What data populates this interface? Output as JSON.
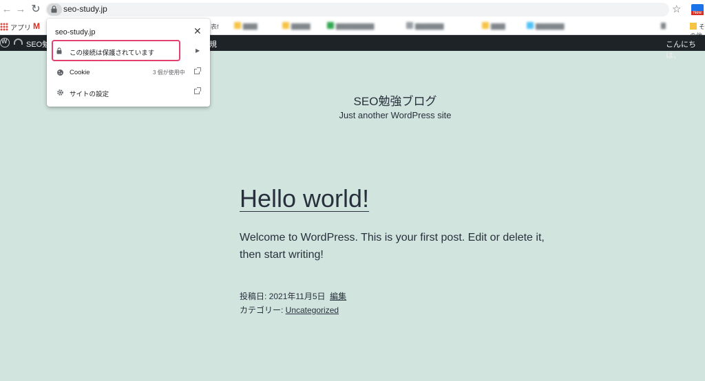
{
  "browser": {
    "url": "seo-study.jp",
    "bookmarks": {
      "apps_label": "アプリ",
      "gmail_label": "M",
      "partial_label": "表f",
      "right_label": "その他"
    }
  },
  "adminbar": {
    "site_name": "SEO勉",
    "new_label": "規",
    "howdy": "こんにちは、"
  },
  "popup": {
    "host": "seo-study.jp",
    "close": "✕",
    "secure_label": "この接続は保護されています",
    "cookie_label": "Cookie",
    "cookie_count": "3 個が使用中",
    "site_settings_label": "サイトの設定"
  },
  "site": {
    "title": "SEO勉強ブログ",
    "description": "Just another WordPress site"
  },
  "post": {
    "title": "Hello world!",
    "body": "Welcome to WordPress. This is your first post. Edit or delete it, then start writing!",
    "posted_on_label": "投稿日: ",
    "posted_on": "2021年11月5日",
    "edit_label": "編集",
    "category_label": "カテゴリー: ",
    "category": "Uncategorized"
  },
  "colors": {
    "page_bg": "#d1e4dd",
    "text": "#28303d",
    "admin_bar": "#1d2327",
    "highlight": "#e4406f"
  }
}
